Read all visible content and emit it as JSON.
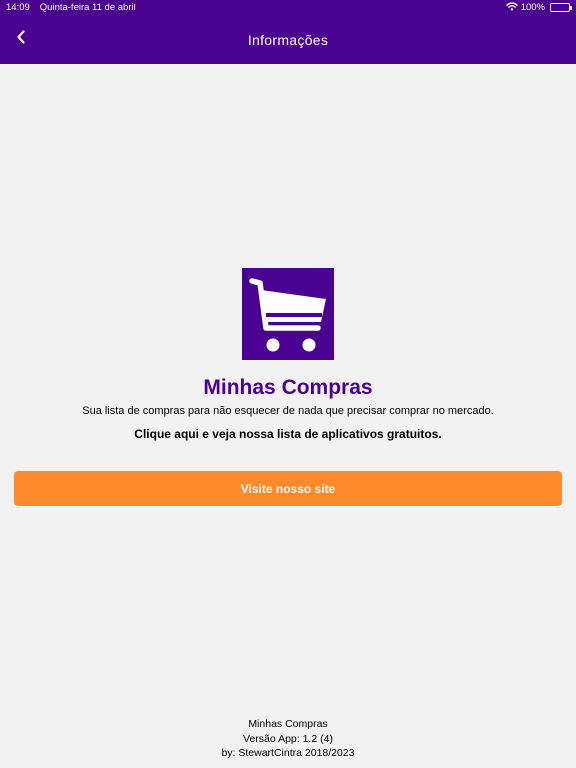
{
  "status_bar": {
    "time": "14:09",
    "date": "Quinta-feira 11 de abril",
    "battery": "100%",
    "battery_level": 1.0
  },
  "nav": {
    "title": "Informações",
    "back_icon": "chevron-left-icon"
  },
  "app": {
    "logo_icon": "shopping-cart-icon",
    "name": "Minhas Compras",
    "description": "Sua lista de compras para não esquecer de nada que precisar comprar no mercado.",
    "apps_link": "Clique aqui e veja nossa lista de aplicativos gratuitos."
  },
  "visit_button": {
    "label": "Visite nosso site"
  },
  "footer": {
    "app_name": "Minhas Compras",
    "version": "Versão App: 1.2 (4)",
    "author": "by: StewartCintra 2018/2023"
  },
  "colors": {
    "primary": "#4a0090",
    "accent": "#ff8a2b",
    "background": "#f2f2f2"
  }
}
